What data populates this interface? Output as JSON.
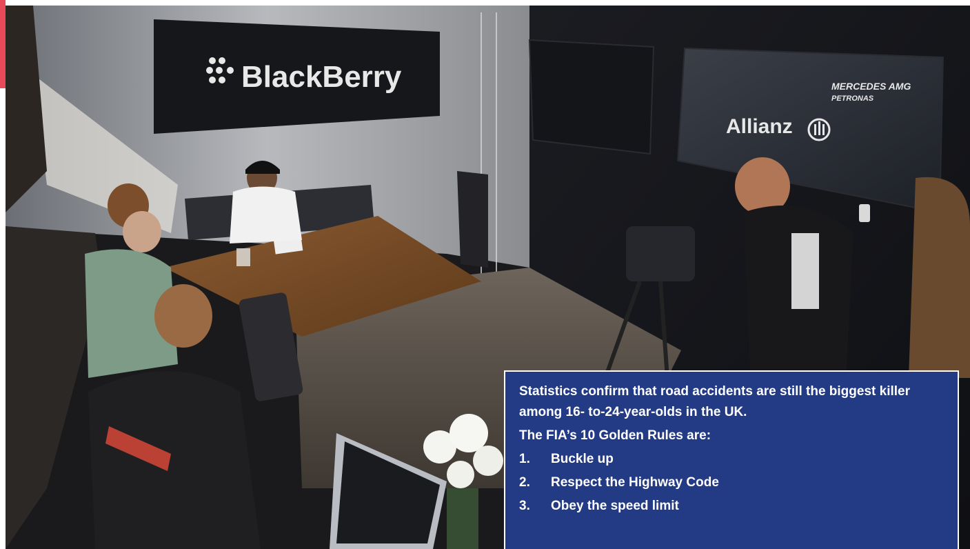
{
  "photo": {
    "sign_left": "BlackBerry",
    "sign_right_top_line1": "MERCEDES AMG",
    "sign_right_top_line2": "PETRONAS",
    "sign_right_brand": "Allianz"
  },
  "colors": {
    "accent": "#e84a5a",
    "box_background": "#233a85",
    "box_text": "#ffffff"
  },
  "info_box": {
    "intro": "Statistics confirm that road accidents are still the biggest killer among 16- to-24-year-olds in the UK.",
    "rules_heading": "The FIA’s 10 Golden Rules are:",
    "rules": [
      {
        "num": "1.",
        "text": "Buckle up"
      },
      {
        "num": "2.",
        "text": "Respect the Highway Code"
      },
      {
        "num": "3.",
        "text": "Obey the speed limit"
      }
    ]
  }
}
